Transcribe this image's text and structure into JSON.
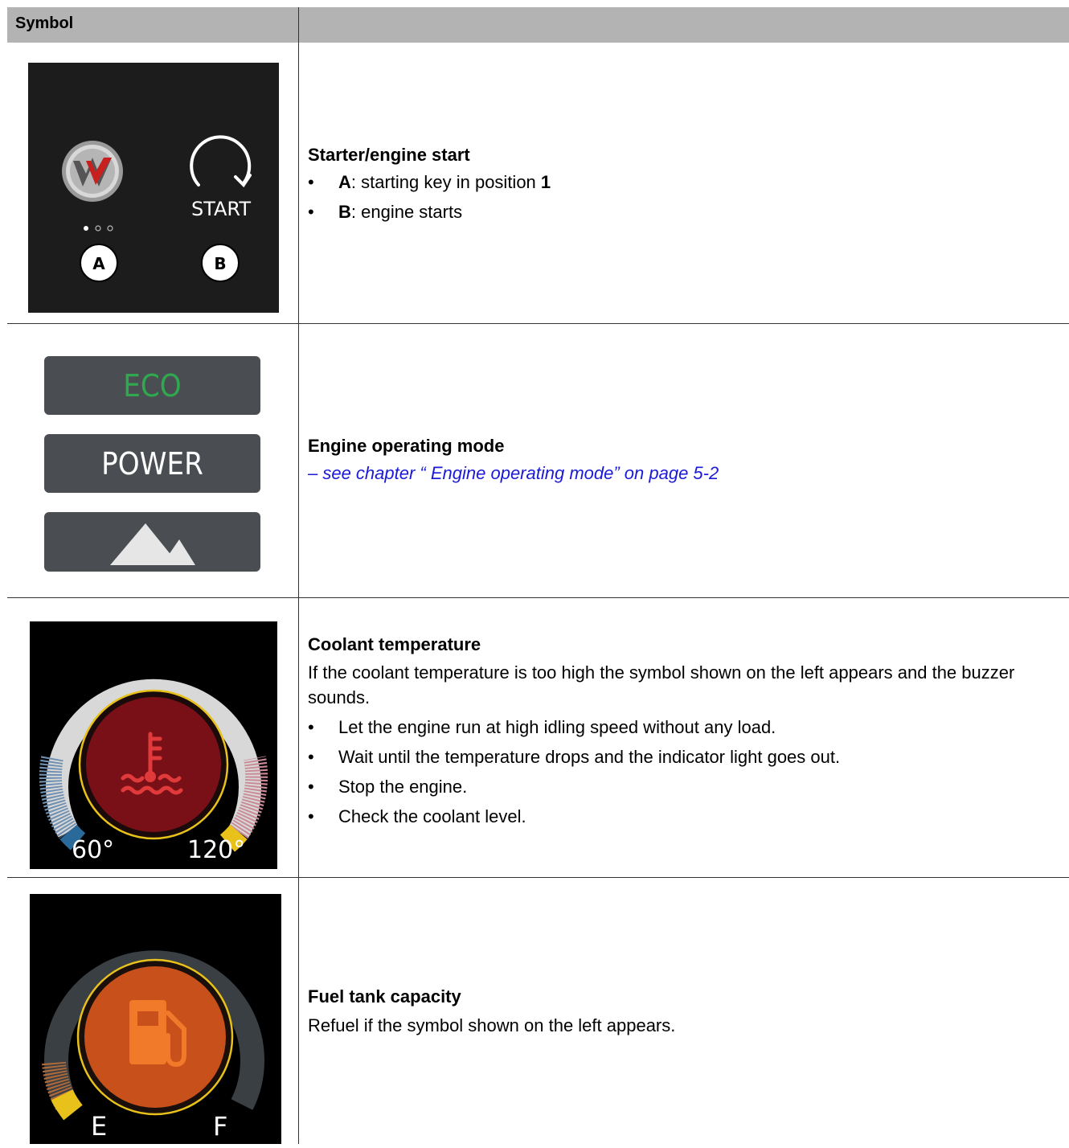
{
  "header": {
    "symbol_label": "Symbol"
  },
  "rows": [
    {
      "title": "Starter/engine start",
      "bullets": [
        {
          "key": "A",
          "text": ": starting key in position ",
          "suffix": "1"
        },
        {
          "key": "B",
          "text": ": engine starts",
          "suffix": ""
        }
      ],
      "symbol": {
        "start_label": "START",
        "marker_a": "A",
        "marker_b": "B",
        "logo_letter": "W"
      }
    },
    {
      "title": "Engine operating mode",
      "link_text": "– see chapter “ Engine operating mode” on page 5-2",
      "symbol": {
        "eco_label": "ECO",
        "power_label": "POWER",
        "eco_color": "#2fa84f"
      }
    },
    {
      "title": "Coolant temperature",
      "body": "If the coolant temperature is too high the symbol shown on the left appears and the buzzer sounds.",
      "bullets": [
        "Let the engine run at high idling speed without any load.",
        "Wait until the temperature drops and the indicator light goes out.",
        "Stop the engine.",
        "Check the coolant level."
      ],
      "symbol": {
        "min_label": "60°",
        "max_label": "120°",
        "warn_color": "#7a1017",
        "ring_color": "#e8c21a"
      }
    },
    {
      "title": "Fuel tank capacity",
      "body": "Refuel if the symbol shown on the left appears.",
      "symbol": {
        "empty_label": "E",
        "full_label": "F",
        "warn_color": "#c8501a",
        "ring_color": "#e8c21a"
      }
    }
  ]
}
